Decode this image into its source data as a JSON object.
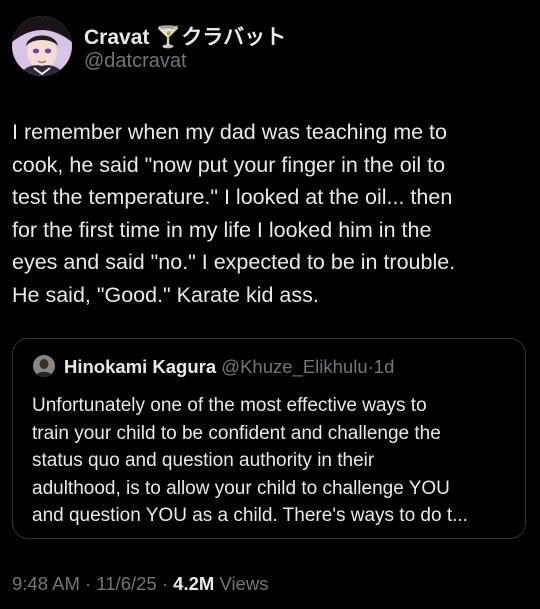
{
  "author": {
    "display_name": "Cravat 🍸クラバット",
    "handle": "@datcravat",
    "avatar": "avatar-anime-character"
  },
  "tweet": {
    "text": "I remember when my dad was teaching me to\ncook, he said \"now put your finger in the oil to\ntest the temperature.\" I looked at the oil... then\nfor the first time in my life I looked him in the\neyes and said \"no.\" I expected to be in trouble.\nHe said, \"Good.\" Karate kid ass."
  },
  "quote": {
    "display_name": "Hinokami Kagura",
    "handle": "@Khuze_Elikhulu",
    "separator": "·",
    "time": "1d",
    "text": "Unfortunately one of the most effective ways to\ntrain your child to be confident and challenge the\nstatus quo and question authority in their\nadulthood, is to allow your child to challenge YOU\nand question YOU as a child. There's ways to do t..."
  },
  "meta": {
    "time": "9:48 AM",
    "separator": "·",
    "date": "11/6/25",
    "views_count": "4.2M",
    "views_label": "Views"
  },
  "colors": {
    "background": "#000000",
    "primary_text": "#e7e9ea",
    "secondary_text": "#71767b",
    "border": "#2f3336"
  }
}
